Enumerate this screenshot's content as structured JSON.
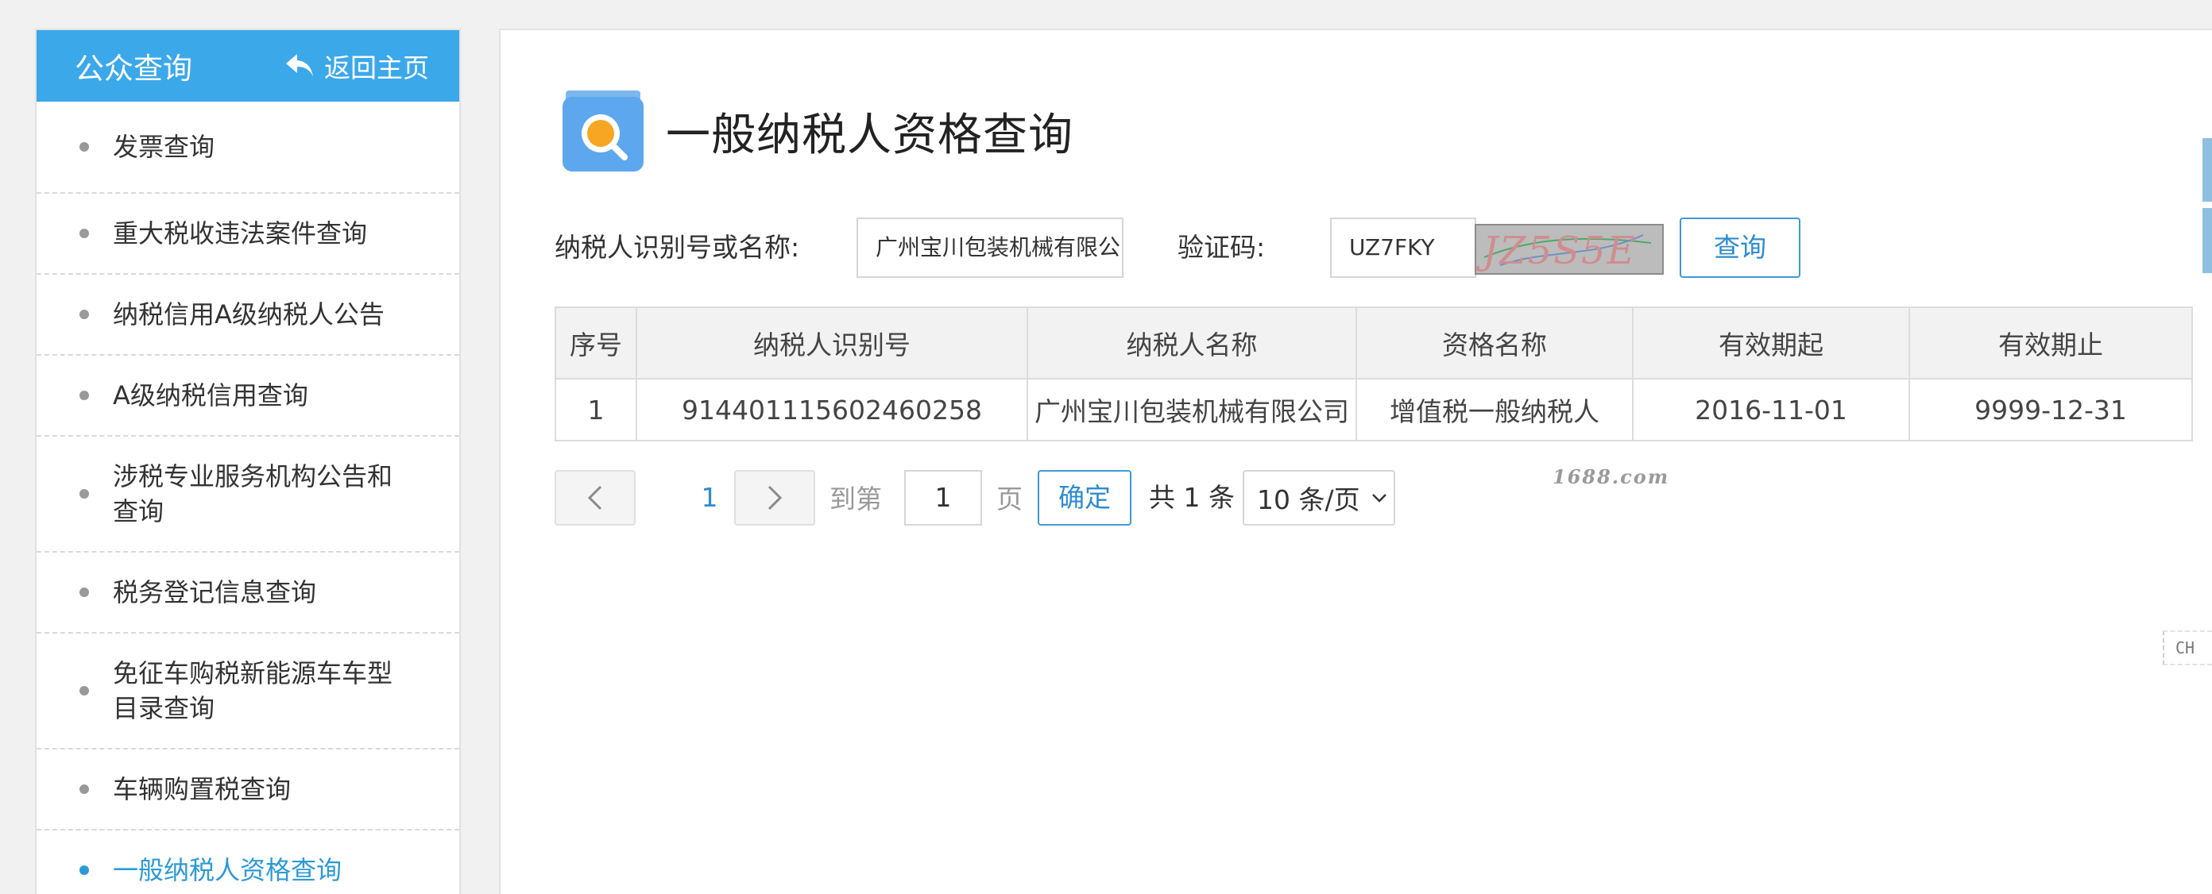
{
  "sidebar": {
    "title": "公众查询",
    "back_label": "返回主页",
    "items": [
      {
        "label": "发票查询"
      },
      {
        "label": "重大税收违法案件查询"
      },
      {
        "label": "纳税信用A级纳税人公告"
      },
      {
        "label": "A级纳税信用查询"
      },
      {
        "label": "涉税专业服务机构公告和查询"
      },
      {
        "label": "税务登记信息查询"
      },
      {
        "label": "免征车购税新能源车车型目录查询"
      },
      {
        "label": "车辆购置税查询"
      },
      {
        "label": "一般纳税人资格查询",
        "active": true
      }
    ]
  },
  "main": {
    "title": "一般纳税人资格查询",
    "icon": "search-doc-icon",
    "search": {
      "taxpayer_label": "纳税人识别号或名称:",
      "taxpayer_value": "广州宝川包装机械有限公司",
      "captcha_label": "验证码:",
      "captcha_value": "UZ7FKY",
      "captcha_image_text": "JZ5S5E",
      "query_button": "查询"
    },
    "table": {
      "headers": [
        "序号",
        "纳税人识别号",
        "纳税人名称",
        "资格名称",
        "有效期起",
        "有效期止"
      ],
      "rows": [
        [
          "1",
          "914401115602460258",
          "广州宝川包装机械有限公司",
          "增值税一般纳税人",
          "2016-11-01",
          "9999-12-31"
        ]
      ]
    },
    "pagination": {
      "current_page": "1",
      "goto_label": "到第",
      "goto_value": "1",
      "page_unit": "页",
      "confirm_label": "确定",
      "total_label": "共 1 条",
      "page_size": "10 条/页"
    },
    "watermark": "1688.com"
  },
  "edge": {
    "ime_badge": "CH"
  },
  "colors": {
    "header_blue": "#3ba8ea",
    "link_blue": "#2f8ccd",
    "active_blue": "#2c9ad6"
  }
}
